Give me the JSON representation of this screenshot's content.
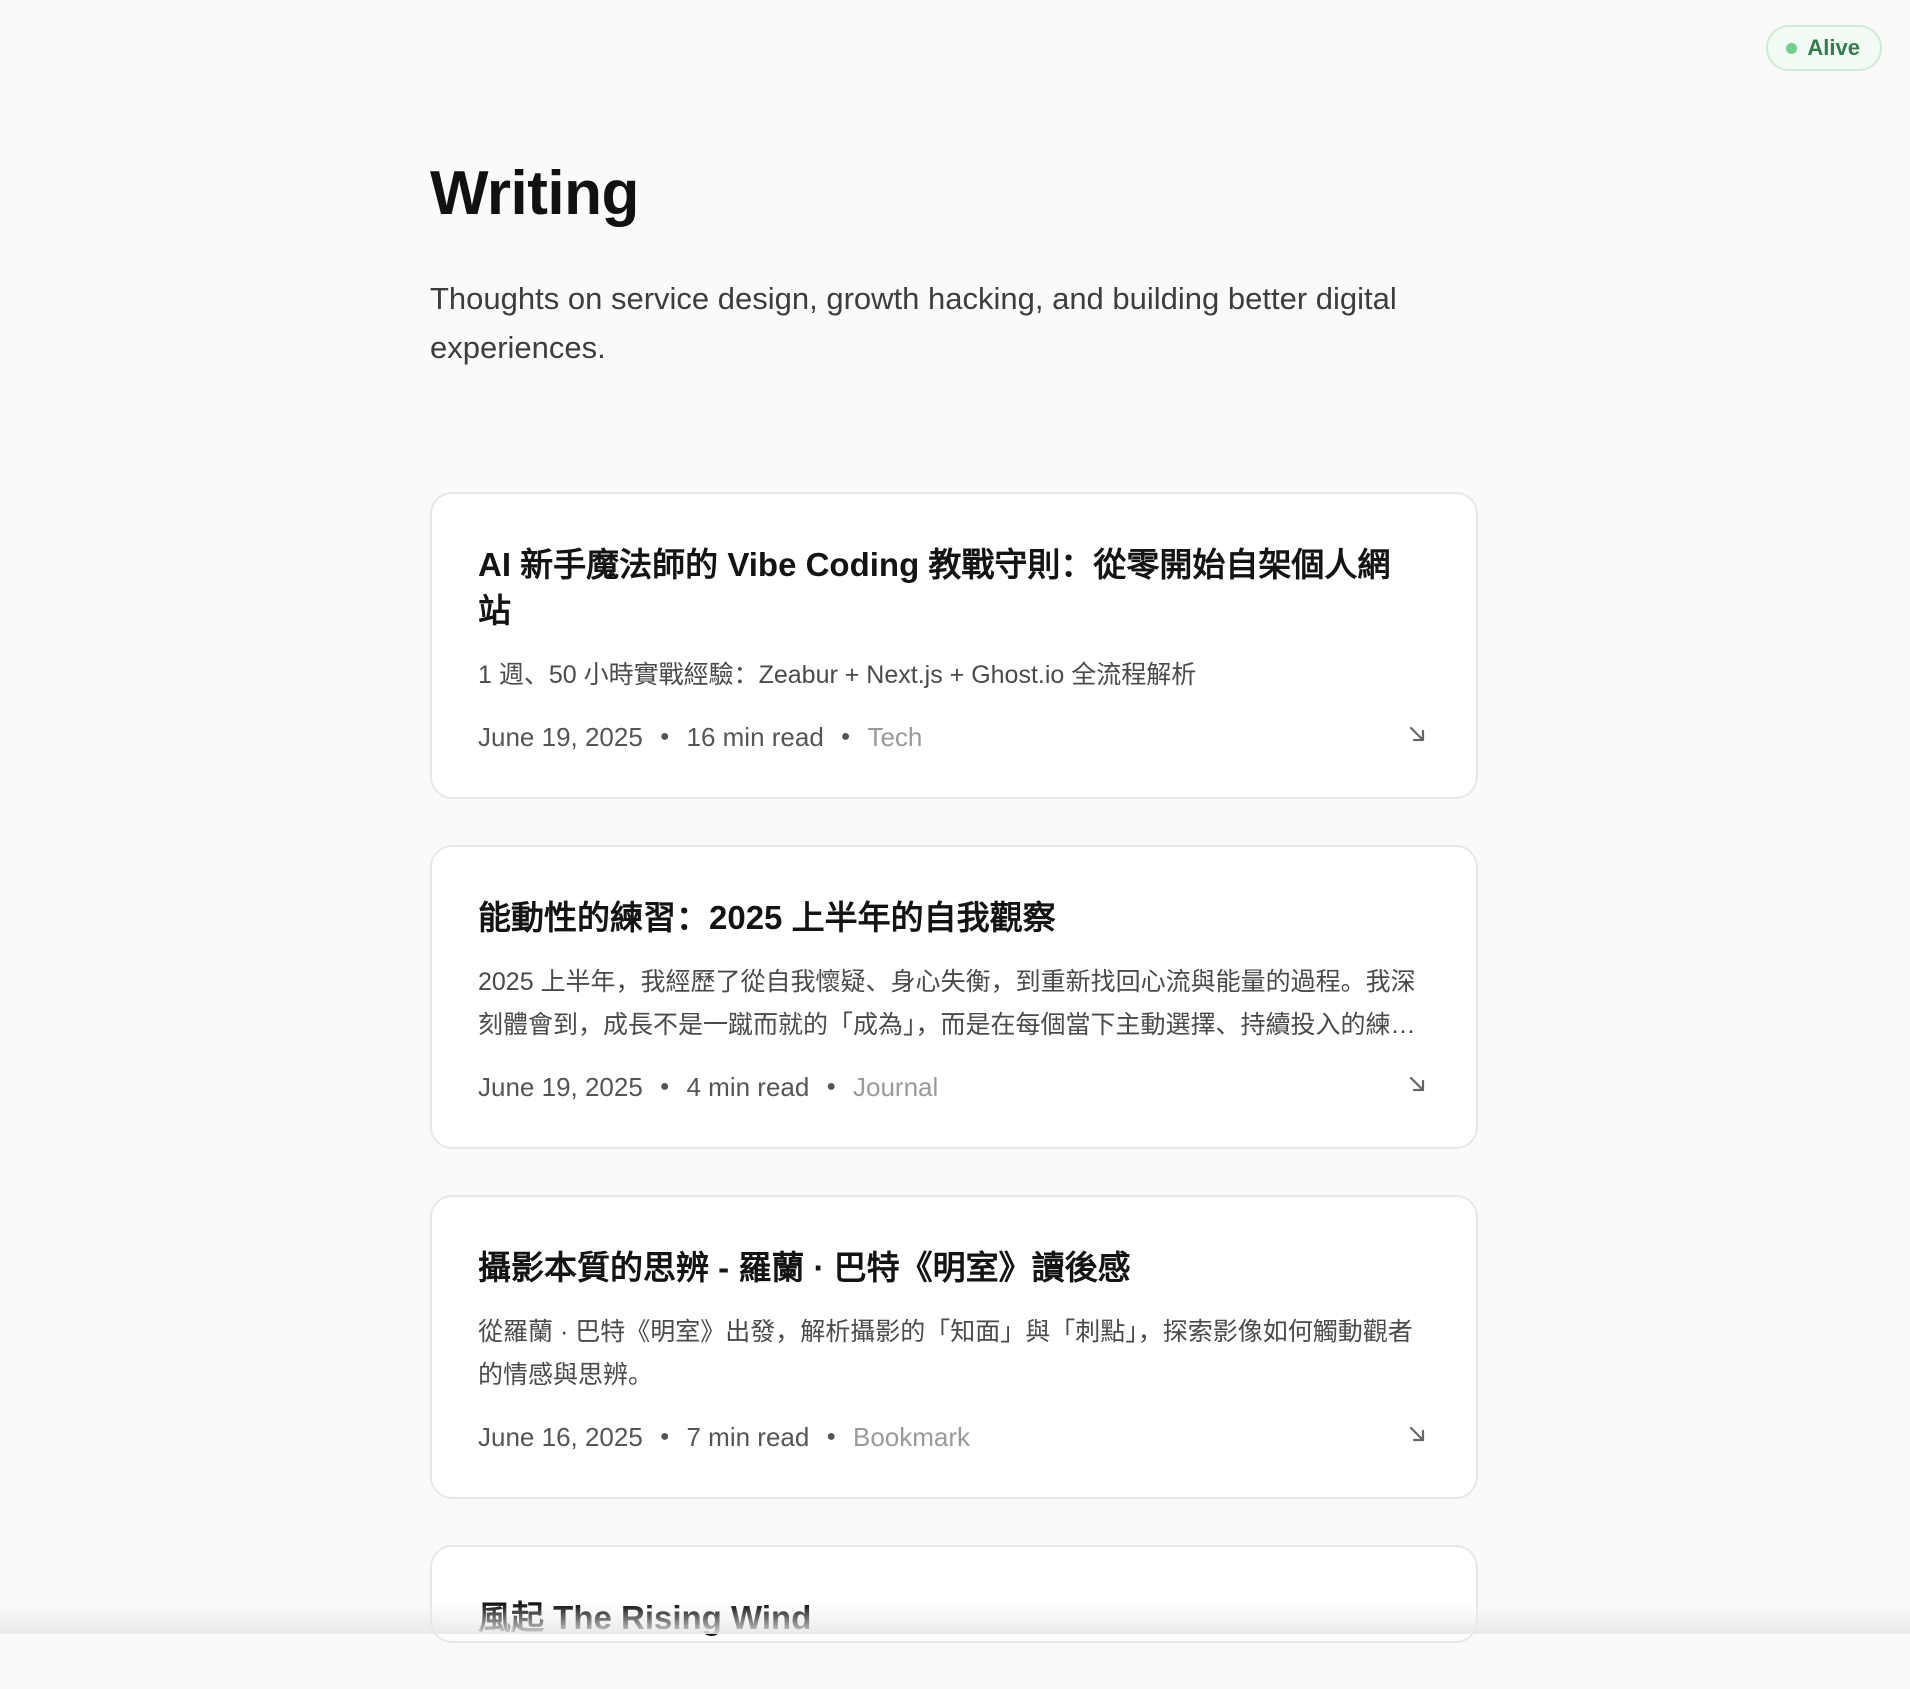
{
  "status": {
    "label": "Alive",
    "color": "#6fcf8d"
  },
  "header": {
    "title": "Writing",
    "subtitle": "Thoughts on service design, growth hacking, and building better digital experiences."
  },
  "posts": [
    {
      "title": "AI 新手魔法師的 Vibe Coding 教戰守則：從零開始自架個人網站",
      "excerpt": "1 週、50 小時實戰經驗：Zeabur + Next.js + Ghost.io 全流程解析",
      "date": "June 19, 2025",
      "read_time": "16 min read",
      "tag": "Tech"
    },
    {
      "title": "能動性的練習：2025 上半年的自我觀察",
      "excerpt": "2025 上半年，我經歷了從自我懷疑、身心失衡，到重新找回心流與能量的過程。我深刻體會到，成長不是一蹴而就的「成為」，而是在每個當下主動選擇、持續投入的練習。",
      "date": "June 19, 2025",
      "read_time": "4 min read",
      "tag": "Journal"
    },
    {
      "title": "攝影本質的思辨 - 羅蘭 · 巴特《明室》讀後感",
      "excerpt": "從羅蘭 · 巴特《明室》出發，解析攝影的「知面」與「刺點」，探索影像如何觸動觀者的情感與思辨。",
      "date": "June 16, 2025",
      "read_time": "7 min read",
      "tag": "Bookmark"
    },
    {
      "title": "風起 The Rising Wind",
      "excerpt": "",
      "date": "",
      "read_time": "",
      "tag": ""
    }
  ],
  "icons": {
    "post_link": "arrow-down-right-icon",
    "status": "status-dot-icon"
  }
}
